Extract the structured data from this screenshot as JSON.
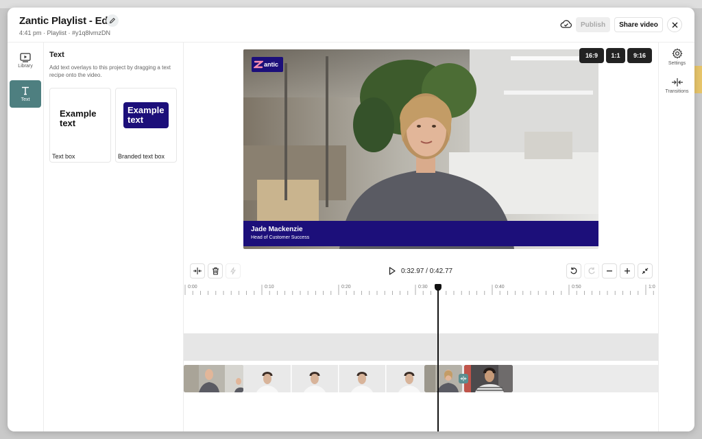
{
  "header": {
    "title": "Zantic Playlist - Edit",
    "meta": "4:41 pm · Playlist · #y1q8lvmzDN",
    "publish_label": "Publish",
    "share_label": "Share video"
  },
  "left_rail": {
    "items": [
      {
        "label": "Library",
        "icon": "play-screen-icon",
        "active": false
      },
      {
        "label": "Text",
        "icon": "text-t-icon",
        "active": true
      }
    ]
  },
  "panel": {
    "title": "Text",
    "description": "Add text overlays to this project by dragging a text recipe onto the video.",
    "cards": [
      {
        "preview": "Example text",
        "label": "Text box"
      },
      {
        "preview": "Example text",
        "label": "Branded text box"
      }
    ]
  },
  "right_rail": {
    "items": [
      {
        "label": "Settings",
        "icon": "gear-icon"
      },
      {
        "label": "Transitions",
        "icon": "transitions-icon"
      }
    ]
  },
  "video": {
    "logo_text": "antic",
    "lower_third_name": "Jade Mackenzie",
    "lower_third_role": "Head of Customer Success",
    "aspect_options": [
      "16:9",
      "1:1",
      "9:16"
    ]
  },
  "timeline": {
    "current_time": "0:32.97",
    "total_time": "0:42.77",
    "time_display": "0:32.97 / 0:42.77",
    "ruler_labels": [
      "0:00",
      "0:10",
      "0:20",
      "0:30",
      "0:40",
      "0:50",
      "1:0"
    ]
  },
  "colors": {
    "accent": "#4e7f80",
    "brand_navy": "#1c0f7a",
    "playhead": "#111111"
  }
}
